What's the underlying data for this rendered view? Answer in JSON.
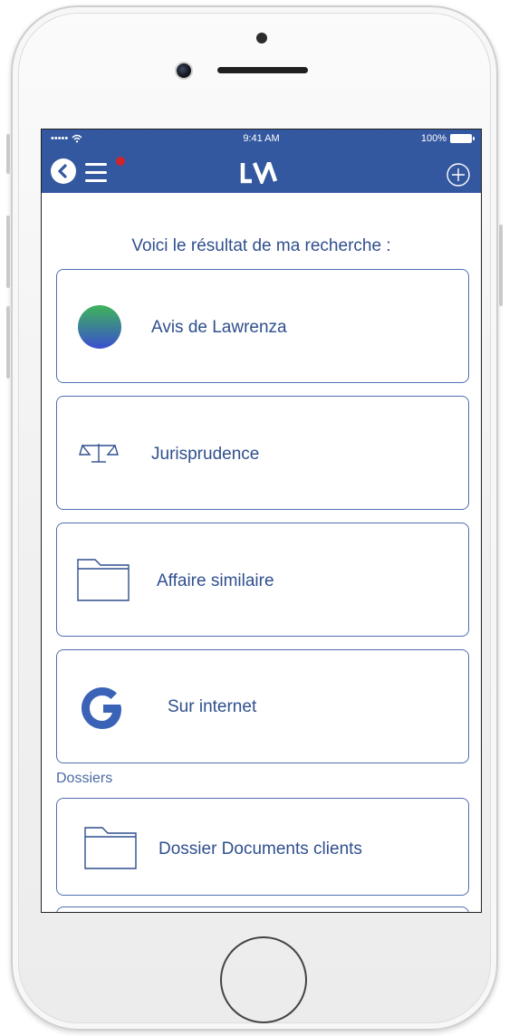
{
  "status_bar": {
    "signal": "•••••",
    "time": "9:41 AM",
    "battery": "100%"
  },
  "header": {
    "logo": "LV",
    "back_icon": "chevron-left-icon",
    "menu_icon": "hamburger-menu-icon",
    "add_icon": "plus-circle-icon",
    "notification": true
  },
  "main": {
    "heading": "Voici le résultat de ma recherche :",
    "results": [
      {
        "label": "Avis de Lawrenza",
        "icon": "gradient-circle-icon"
      },
      {
        "label": "Jurisprudence",
        "icon": "scales-icon"
      },
      {
        "label": "Affaire similaire",
        "icon": "folder-icon"
      },
      {
        "label": "Sur internet",
        "icon": "google-g-icon"
      }
    ],
    "section_label": "Dossiers",
    "folders": [
      {
        "label": "Dossier Documents clients",
        "icon": "folder-icon"
      }
    ]
  },
  "colors": {
    "header_bg": "#33589f",
    "text_primary": "#2f4f8e",
    "card_border": "#4f70ad",
    "notification_dot": "#d0232a",
    "circle_gradient_top": "#3fb45a",
    "circle_gradient_bottom": "#3a4fd0"
  }
}
